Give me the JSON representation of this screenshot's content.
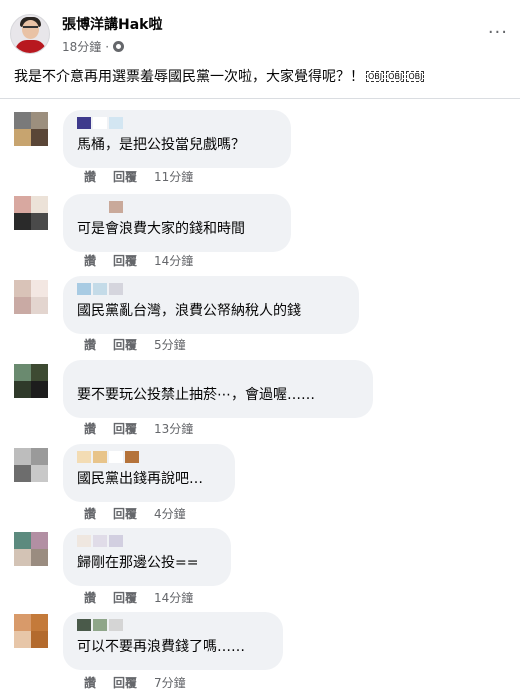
{
  "post": {
    "author": "張博洋講Hak啦",
    "time": "18分鐘",
    "privacy_icon": "globe-icon",
    "text": "我是不介意再用選票羞辱國民黨一次啦，大家覺得呢？！",
    "obj_marks": [
      "OBJ",
      "OBJ",
      "OBJ"
    ],
    "more_icon": "more-options-icon",
    "more_glyph": "···"
  },
  "comments": [
    {
      "text": "馬桶，是把公投當兒戲嗎？",
      "like": "讚",
      "reply": "回覆",
      "time": "11分鐘",
      "avatar_colors": [
        "#7a7a7a",
        "#9c8f7e",
        "#c7a46f",
        "#5a4637"
      ],
      "name_colors": [
        "#3e3a8c",
        "#ffffff",
        "#d3e6f2"
      ]
    },
    {
      "text": "可是會浪費大家的錢和時間",
      "like": "讚",
      "reply": "回覆",
      "time": "14分鐘",
      "avatar_colors": [
        "#d8a8a0",
        "#ece2d8",
        "#2a2a2a",
        "#4a4a4a"
      ],
      "name_colors": [
        "#f0f2f5",
        "#f0f2f5",
        "#c9a99a"
      ]
    },
    {
      "text": "國民黨亂台灣，浪費公帑納稅人的錢",
      "like": "讚",
      "reply": "回覆",
      "time": "5分鐘",
      "avatar_colors": [
        "#d9c3b8",
        "#f3e7e2",
        "#c9aaa4",
        "#e3d5cf"
      ],
      "name_colors": [
        "#a8cbe3",
        "#c4dbe8",
        "#d5d5dd"
      ]
    },
    {
      "text": "要不要玩公投禁止抽菸⋯，會過喔……",
      "like": "讚",
      "reply": "回覆",
      "time": "13分鐘",
      "avatar_colors": [
        "#6a8a6f",
        "#3d4a32",
        "#2f3a2a",
        "#1d1d1d"
      ],
      "name_colors": [
        "#f0f2f5",
        "#f0f2f5",
        "#f0f2f5"
      ]
    },
    {
      "text": "國民黨出錢再說吧…",
      "like": "讚",
      "reply": "回覆",
      "time": "4分鐘",
      "avatar_colors": [
        "#bdbdbd",
        "#9a9a9a",
        "#6d6d6d",
        "#c8c8c8"
      ],
      "name_colors": [
        "#f3dcb4",
        "#e8c48a",
        "#ffffff",
        "#b5733a"
      ]
    },
    {
      "text": "歸剛在那邊公投==",
      "like": "讚",
      "reply": "回覆",
      "time": "14分鐘",
      "avatar_colors": [
        "#5c8a7e",
        "#b28fa3",
        "#d3c3b5",
        "#9a8c80"
      ],
      "name_colors": [
        "#efe7e0",
        "#e0dce8",
        "#d2cfe0"
      ]
    },
    {
      "text": "可以不要再浪費錢了嗎……",
      "like": "讚",
      "reply": "回覆",
      "time": "7分鐘",
      "avatar_colors": [
        "#d89a6a",
        "#c47a3a",
        "#e7c6a8",
        "#b36a2d"
      ],
      "name_colors": [
        "#4a5a4a",
        "#8fa68a",
        "#d5d5d5"
      ]
    }
  ]
}
